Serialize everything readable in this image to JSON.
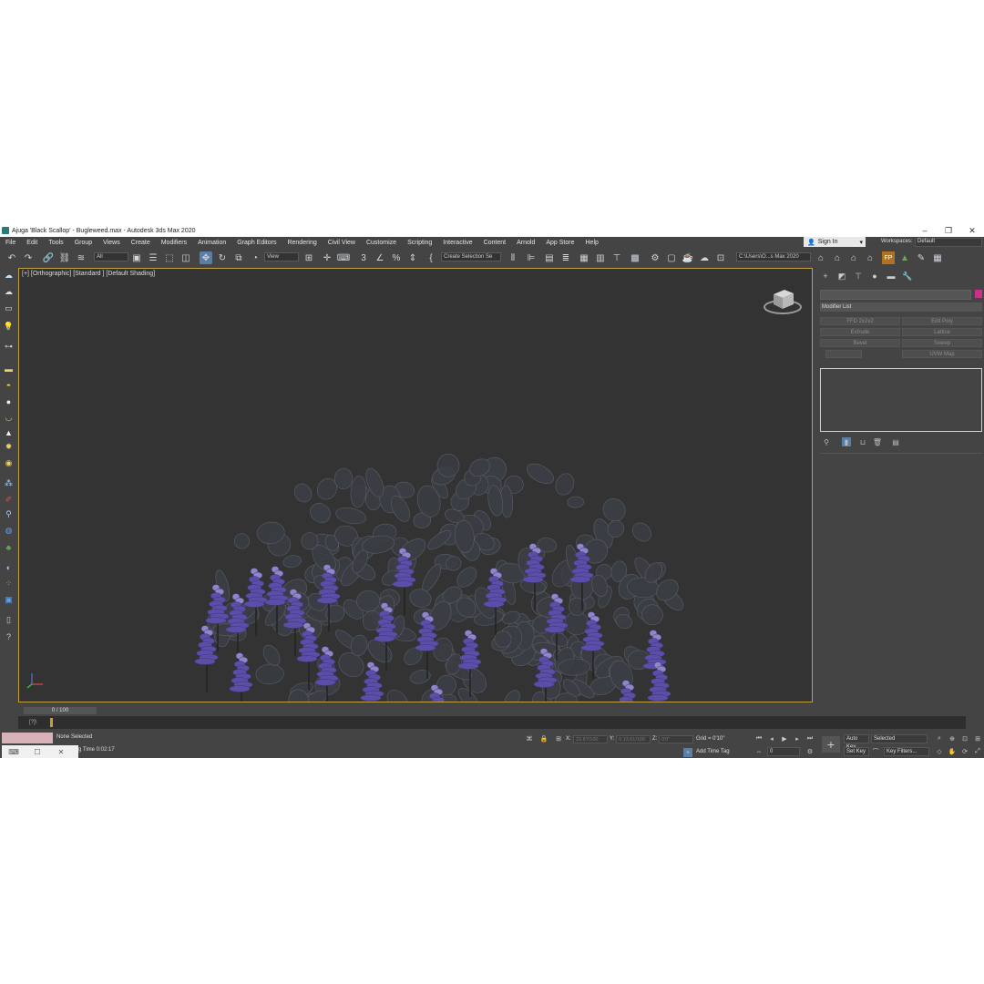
{
  "window": {
    "title": "Ajuga 'Black Scallop' - Bugleweed.max - Autodesk 3ds Max 2020",
    "controls": [
      "–",
      "❐",
      "✕"
    ]
  },
  "menu": {
    "items": [
      "File",
      "Edit",
      "Tools",
      "Group",
      "Views",
      "Create",
      "Modifiers",
      "Animation",
      "Graph Editors",
      "Rendering",
      "Civil View",
      "Customize",
      "Scripting",
      "Interactive",
      "Content",
      "Arnold",
      "App Store",
      "Help"
    ],
    "sign_in": "Sign In",
    "workspaces_label": "Workspaces:",
    "workspace_value": "Default"
  },
  "toolbar": {
    "filter_value": "All",
    "ref_coord_value": "View",
    "selection_set_value": "Create Selection Se",
    "project_path": "C:\\Users\\O...s Max 2020"
  },
  "viewport": {
    "label": "[+] [Orthographic] [Standard ] [Default Shading]"
  },
  "command_panel": {
    "modifier_list_label": "Modifier List",
    "modifier_buttons": [
      "FFD 2x2x2",
      "Edit Poly",
      "Extrude",
      "Lattice",
      "Bevel",
      "Sweep",
      "",
      "UVW Map"
    ]
  },
  "timeline": {
    "slider_text": "0 / 100",
    "track_label": "[?]\\"
  },
  "status": {
    "selection": "None Selected",
    "render_time": "g Time  0:02:17",
    "x_label": "X:",
    "x_value": "23.87/100",
    "y_label": "Y:",
    "y_value": "0 13.61/100",
    "z_label": "Z:",
    "z_value": "0'0\"",
    "grid": "Grid = 0'10\"",
    "add_time_tag": "Add Time Tag",
    "auto_key": "Auto Key",
    "set_key": "Set Key",
    "selected_value": "Selected",
    "frame_value": "0",
    "key_filters": "Key Filters..."
  },
  "colors": {
    "accent_active": "#5b7ea6",
    "viewport_border": "#c3a244",
    "flower": "#5b4ea8",
    "leaf": "#3a3d43"
  }
}
